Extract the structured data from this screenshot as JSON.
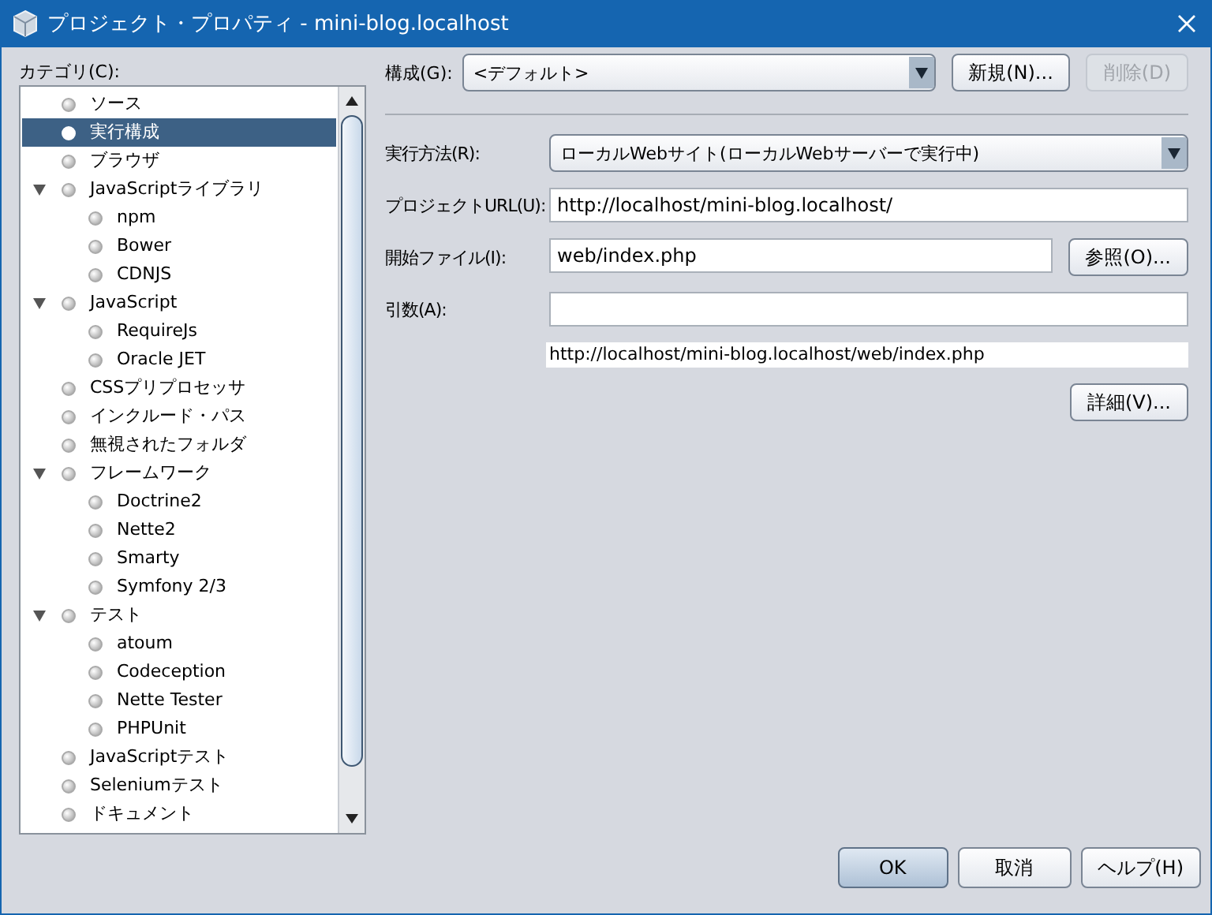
{
  "window": {
    "title": "プロジェクト・プロパティ - mini-blog.localhost"
  },
  "category_label": "カテゴリ(C):",
  "categories": [
    {
      "label": "ソース",
      "selected": false
    },
    {
      "label": "実行構成",
      "selected": true
    },
    {
      "label": "ブラウザ",
      "selected": false
    },
    {
      "label": "JavaScriptライブラリ",
      "selected": false,
      "expanded": true,
      "children": [
        {
          "label": "npm",
          "selected": false
        },
        {
          "label": "Bower",
          "selected": false
        },
        {
          "label": "CDNJS",
          "selected": false
        }
      ]
    },
    {
      "label": "JavaScript",
      "selected": false,
      "expanded": true,
      "children": [
        {
          "label": "RequireJs",
          "selected": false
        },
        {
          "label": "Oracle JET",
          "selected": false
        }
      ]
    },
    {
      "label": "CSSプリプロセッサ",
      "selected": false
    },
    {
      "label": "インクルード・パス",
      "selected": false
    },
    {
      "label": "無視されたフォルダ",
      "selected": false
    },
    {
      "label": "フレームワーク",
      "selected": false,
      "expanded": true,
      "children": [
        {
          "label": "Doctrine2",
          "selected": false
        },
        {
          "label": "Nette2",
          "selected": false
        },
        {
          "label": "Smarty",
          "selected": false
        },
        {
          "label": "Symfony 2/3",
          "selected": false
        }
      ]
    },
    {
      "label": "テスト",
      "selected": false,
      "expanded": true,
      "children": [
        {
          "label": "atoum",
          "selected": false
        },
        {
          "label": "Codeception",
          "selected": false
        },
        {
          "label": "Nette Tester",
          "selected": false
        },
        {
          "label": "PHPUnit",
          "selected": false
        }
      ]
    },
    {
      "label": "JavaScriptテスト",
      "selected": false
    },
    {
      "label": "Seleniumテスト",
      "selected": false
    },
    {
      "label": "ドキュメント",
      "selected": false
    }
  ],
  "configuration": {
    "label": "構成(G):",
    "value": "<デフォルト>"
  },
  "config_buttons": [
    {
      "label": "新規(N)...",
      "disabled": false
    },
    {
      "label": "削除(D)",
      "disabled": true
    }
  ],
  "fields": [
    {
      "kind": "dropdown",
      "label": "実行方法(R):",
      "value": "ローカルWebサイト(ローカルWebサーバーで実行中)"
    },
    {
      "kind": "text",
      "label": "プロジェクトURL(U):",
      "value": "http://localhost/mini-blog.localhost/"
    },
    {
      "kind": "text_button",
      "label": "開始ファイル(I):",
      "value": "web/index.php",
      "button": "参照(O)..."
    },
    {
      "kind": "text",
      "label": "引数(A):"
    }
  ],
  "resolved_url": "http://localhost/mini-blog.localhost/web/index.php",
  "details_button": "詳細(V)...",
  "footer_buttons": [
    {
      "label": "OK",
      "default": true
    },
    {
      "label": "取消",
      "default": false
    },
    {
      "label": "ヘルプ(H)",
      "default": false
    }
  ]
}
